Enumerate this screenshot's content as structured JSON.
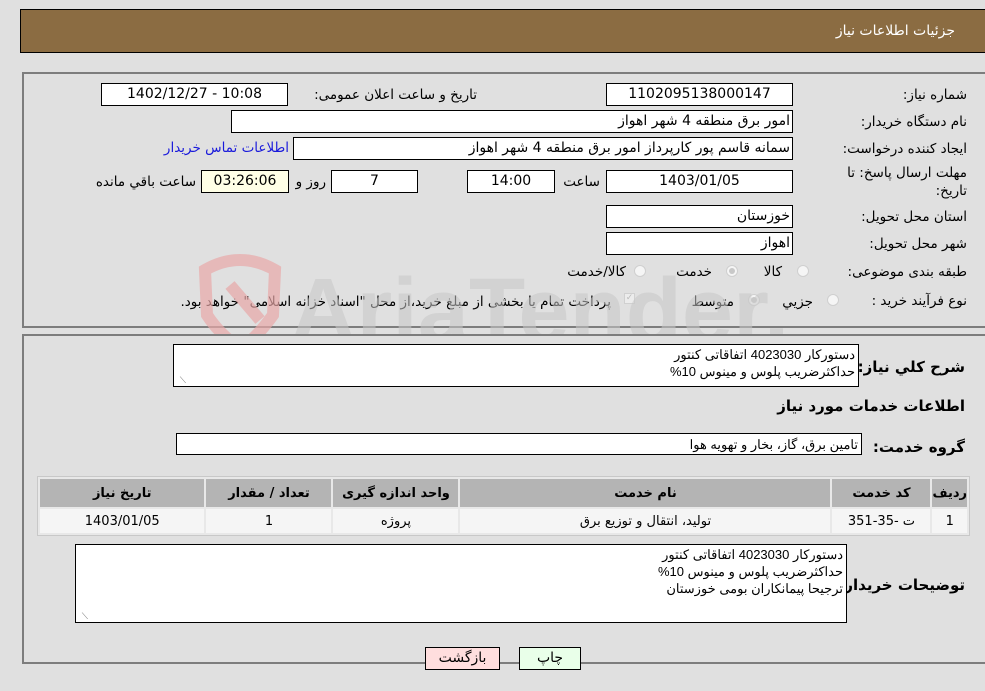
{
  "header": {
    "title": "جزئیات اطلاعات نیاز"
  },
  "form": {
    "need_number": {
      "label": "شماره نیاز:",
      "value": "1102095138000147"
    },
    "announce": {
      "label": "تاریخ و ساعت اعلان عمومی:",
      "value": "1402/12/27 - 10:08"
    },
    "buyer_org": {
      "label": "نام دستگاه خریدار:",
      "value": "امور برق منطقه 4 شهر اهواز"
    },
    "requester": {
      "label": "ایجاد کننده درخواست:",
      "value": "سمانه قاسم پور کارپرداز امور برق منطقه 4 شهر اهواز"
    },
    "contact_link": "اطلاعات تماس خریدار",
    "deadline": {
      "label_line1": "مهلت ارسال پاسخ: تا",
      "label_line2": "تاریخ:",
      "date": "1403/01/05",
      "time_label": "ساعت",
      "time": "14:00",
      "days": "7",
      "days_label": "روز و",
      "remaining": "03:26:06",
      "remaining_label": "ساعت باقي مانده"
    },
    "province": {
      "label": "استان محل تحویل:",
      "value": "خوزستان"
    },
    "city": {
      "label": "شهر محل تحویل:",
      "value": "اهواز"
    },
    "category": {
      "label": "طبقه بندی موضوعی:",
      "options": [
        "کالا",
        "خدمت",
        "کالا/خدمت"
      ],
      "selected": "خدمت"
    },
    "process": {
      "label": "نوع فرآیند خرید :",
      "options": [
        "جزيي",
        "متوسط"
      ],
      "selected": "متوسط",
      "treasury_note": "پرداخت تمام یا بخشی از مبلغ خرید،از محل \"اسناد خزانه اسلامی\" خواهد بود.",
      "treasury_checked": true
    }
  },
  "details": {
    "general_desc_label": "شرح كلي نياز:",
    "general_desc": [
      "دستورکار 4023030 اتفاقاتی کنتور",
      "حداکثرضریب پلوس و مینوس 10%"
    ],
    "services_heading": "اطلاعات خدمات مورد نیاز",
    "service_group_label": "گروه خدمت:",
    "service_group": "تامین برق، گاز، بخار و تهویه هوا",
    "table": {
      "headers": [
        "ردیف",
        "کد خدمت",
        "نام خدمت",
        "واحد اندازه گیری",
        "تعداد / مقدار",
        "تاریخ نیاز"
      ],
      "rows": [
        [
          "1",
          "ت -35-351",
          "تولید، انتقال و توزیع برق",
          "پروژه",
          "1",
          "1403/01/05"
        ]
      ]
    },
    "buyer_notes_label": "توضیحات خریدار:",
    "buyer_notes": [
      "دستورکار 4023030 اتفاقاتی کنتور",
      "حداکثرضریب پلوس و مینوس 10%",
      "ترجیحا پیمانکاران بومی خوزستان"
    ]
  },
  "buttons": {
    "print": "چاپ",
    "back": "بازگشت"
  },
  "watermark": "AriaTender.neT"
}
